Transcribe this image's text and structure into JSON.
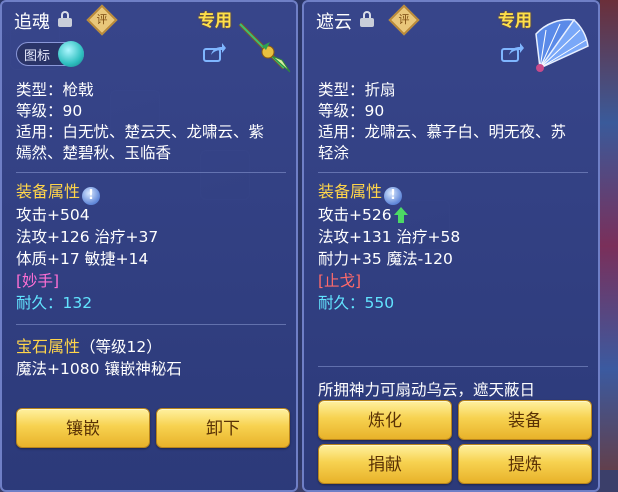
{
  "left": {
    "name": "追魂",
    "eval_label": "评",
    "tag": "专用",
    "toggle_label": "图标",
    "type_line": "类型：枪戟",
    "level_line": "等级：90",
    "suit_line1": "适用：白无忧、楚云天、龙啸云、紫",
    "suit_line2": "嫣然、楚碧秋、玉临香",
    "attr_title": "装备属性",
    "stat1": "攻击+504",
    "stat2": "法攻+126 治疗+37",
    "stat3": "体质+17 敏捷+14",
    "special": "[妙手]",
    "durability_label": "耐久：",
    "durability_value": "132",
    "gem_title": "宝石属性",
    "gem_level": "（等级12）",
    "gem_stat": "魔法+1080 镶嵌神秘石",
    "buttons": [
      "镶嵌",
      "卸下"
    ]
  },
  "right": {
    "name": "遮云",
    "eval_label": "评",
    "tag": "专用",
    "type_line": "类型：折扇",
    "level_line": "等级：90",
    "suit_line1": "适用：龙啸云、慕子白、明无夜、苏",
    "suit_line2": "轻涂",
    "attr_title": "装备属性",
    "stat1": "攻击+526",
    "stat2": "法攻+131 治疗+58",
    "stat3": "耐力+35 魔法-120",
    "special": "[止戈]",
    "durability_label": "耐久：",
    "durability_value": "550",
    "description": "所拥神力可扇动乌云，遮天蔽日",
    "buttons": [
      "炼化",
      "装备",
      "捐献",
      "提炼"
    ]
  },
  "icons": {
    "lock": "lock-icon",
    "eval": "evaluate-icon",
    "share": "share-icon",
    "info": "info-icon",
    "up": "up-arrow-icon",
    "weapon": "spear-icon",
    "fan": "fan-icon"
  },
  "colors": {
    "section": "#ffd54a",
    "special_left": "#ff6fd4",
    "special_right": "#ff6a6a",
    "durability": "#62e4ff",
    "button": "#f7d250",
    "up_arrow": "#4cd964"
  }
}
